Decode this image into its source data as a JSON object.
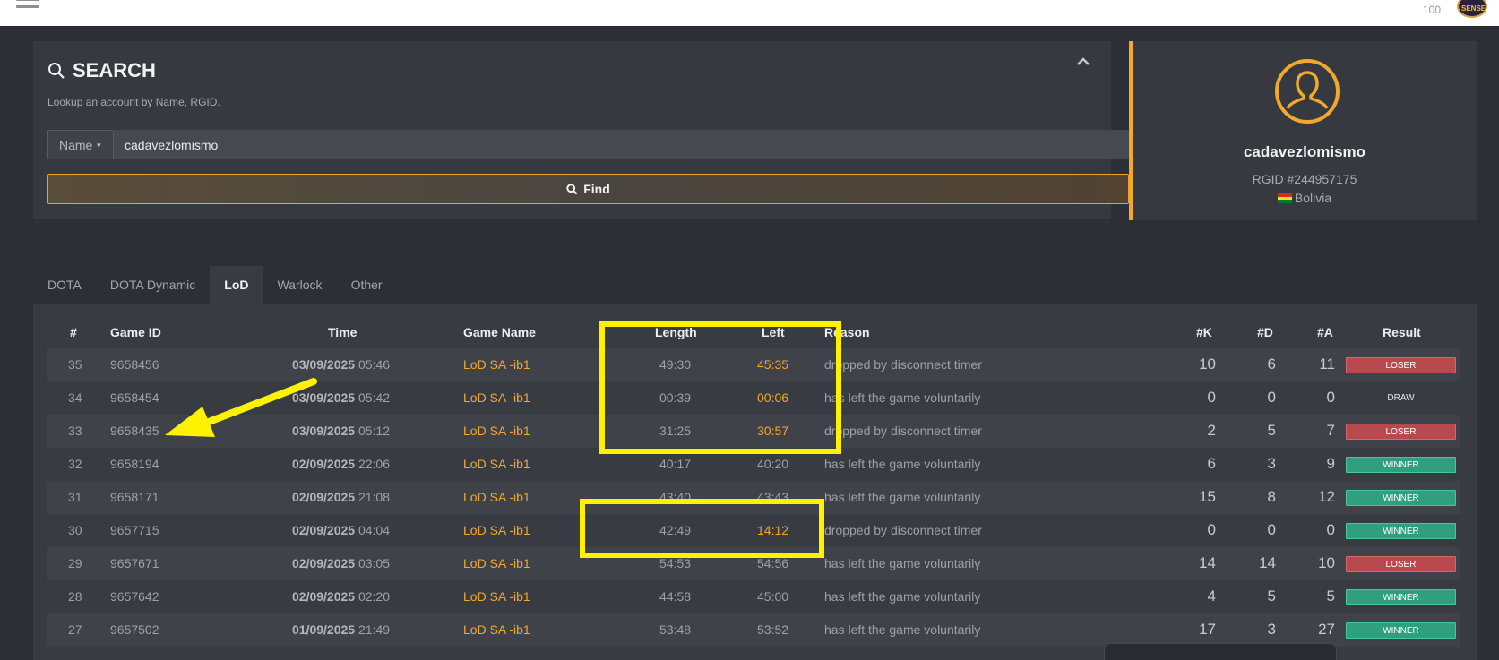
{
  "topbar": {
    "count": "100",
    "avatar_text": "SENSEI"
  },
  "search": {
    "title": "SEARCH",
    "subtitle": "Lookup an account by Name, RGID.",
    "field_type": "Name",
    "value": "cadavezlomismo",
    "find_label": "Find"
  },
  "profile": {
    "name": "cadavezlomismo",
    "rgid": "RGID #244957175",
    "country": "Bolivia",
    "flag_colors": [
      "#d52b1e",
      "#f9e300",
      "#007934"
    ]
  },
  "tabs": [
    "DOTA",
    "DOTA Dynamic",
    "LoD",
    "Warlock",
    "Other"
  ],
  "active_tab": "LoD",
  "table": {
    "headers": {
      "num": "#",
      "game_id": "Game ID",
      "time": "Time",
      "game_name": "Game Name",
      "length": "Length",
      "left": "Left",
      "reason": "Reason",
      "k": "#K",
      "d": "#D",
      "a": "#A",
      "result": "Result"
    },
    "rows": [
      {
        "num": "35",
        "id": "9658456",
        "date": "03/09/2025",
        "clock": "05:46",
        "game": "LoD SA -ib1",
        "length": "49:30",
        "left": "45:35",
        "left_hl": true,
        "reason": "dropped by disconnect timer",
        "k": "10",
        "d": "6",
        "a": "11",
        "result": "LOSER"
      },
      {
        "num": "34",
        "id": "9658454",
        "date": "03/09/2025",
        "clock": "05:42",
        "game": "LoD SA -ib1",
        "length": "00:39",
        "left": "00:06",
        "left_hl": true,
        "reason": "has left the game voluntarily",
        "k": "0",
        "d": "0",
        "a": "0",
        "result": "DRAW"
      },
      {
        "num": "33",
        "id": "9658435",
        "date": "03/09/2025",
        "clock": "05:12",
        "game": "LoD SA -ib1",
        "length": "31:25",
        "left": "30:57",
        "left_hl": true,
        "reason": "dropped by disconnect timer",
        "k": "2",
        "d": "5",
        "a": "7",
        "result": "LOSER"
      },
      {
        "num": "32",
        "id": "9658194",
        "date": "02/09/2025",
        "clock": "22:06",
        "game": "LoD SA -ib1",
        "length": "40:17",
        "left": "40:20",
        "left_hl": false,
        "reason": "has left the game voluntarily",
        "k": "6",
        "d": "3",
        "a": "9",
        "result": "WINNER"
      },
      {
        "num": "31",
        "id": "9658171",
        "date": "02/09/2025",
        "clock": "21:08",
        "game": "LoD SA -ib1",
        "length": "43:40",
        "left": "43:43",
        "left_hl": false,
        "reason": "has left the game voluntarily",
        "k": "15",
        "d": "8",
        "a": "12",
        "result": "WINNER"
      },
      {
        "num": "30",
        "id": "9657715",
        "date": "02/09/2025",
        "clock": "04:04",
        "game": "LoD SA -ib1",
        "length": "42:49",
        "left": "14:12",
        "left_hl": true,
        "reason": "dropped by disconnect timer",
        "k": "0",
        "d": "0",
        "a": "0",
        "result": "WINNER"
      },
      {
        "num": "29",
        "id": "9657671",
        "date": "02/09/2025",
        "clock": "03:05",
        "game": "LoD SA -ib1",
        "length": "54:53",
        "left": "54:56",
        "left_hl": false,
        "reason": "has left the game voluntarily",
        "k": "14",
        "d": "14",
        "a": "10",
        "result": "LOSER"
      },
      {
        "num": "28",
        "id": "9657642",
        "date": "02/09/2025",
        "clock": "02:20",
        "game": "LoD SA -ib1",
        "length": "44:58",
        "left": "45:00",
        "left_hl": false,
        "reason": "has left the game voluntarily",
        "k": "4",
        "d": "5",
        "a": "5",
        "result": "WINNER"
      },
      {
        "num": "27",
        "id": "9657502",
        "date": "01/09/2025",
        "clock": "21:49",
        "game": "LoD SA -ib1",
        "length": "53:48",
        "left": "53:52",
        "left_hl": false,
        "reason": "has left the game voluntarily",
        "k": "17",
        "d": "3",
        "a": "27",
        "result": "WINNER"
      }
    ]
  },
  "annotation_color": "#fff200"
}
